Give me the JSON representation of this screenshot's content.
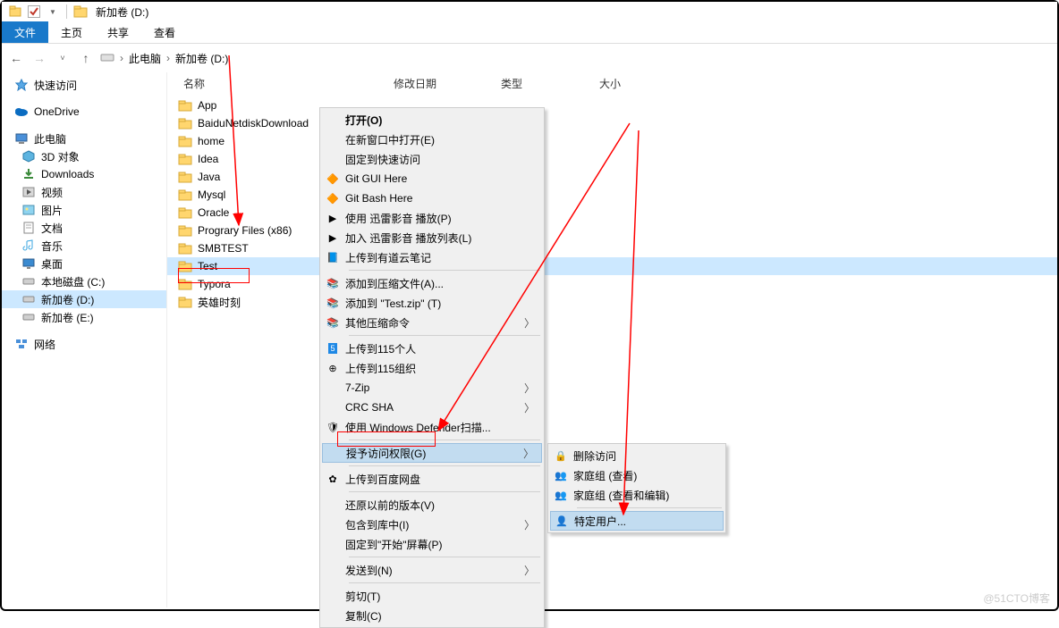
{
  "title": "新加卷 (D:)",
  "tabs": {
    "file": "文件",
    "home": "主页",
    "share": "共享",
    "view": "查看"
  },
  "breadcrumb": {
    "pc": "此电脑",
    "drive": "新加卷 (D:)"
  },
  "columns": {
    "name": "名称",
    "date": "修改日期",
    "type": "类型",
    "size": "大小"
  },
  "sidebar": {
    "quick": "快速访问",
    "onedrive": "OneDrive",
    "pc": "此电脑",
    "items": [
      {
        "label": "3D 对象"
      },
      {
        "label": "Downloads"
      },
      {
        "label": "视频"
      },
      {
        "label": "图片"
      },
      {
        "label": "文档"
      },
      {
        "label": "音乐"
      },
      {
        "label": "桌面"
      },
      {
        "label": "本地磁盘 (C:)"
      },
      {
        "label": "新加卷 (D:)"
      },
      {
        "label": "新加卷 (E:)"
      }
    ],
    "network": "网络"
  },
  "files": [
    {
      "name": "App"
    },
    {
      "name": "BaiduNetdiskDownload"
    },
    {
      "name": "home"
    },
    {
      "name": "Idea"
    },
    {
      "name": "Java"
    },
    {
      "name": "Mysql"
    },
    {
      "name": "Oracle"
    },
    {
      "name": "Prograry Files (x86)"
    },
    {
      "name": "SMBTEST"
    },
    {
      "name": "Test"
    },
    {
      "name": "Typora"
    },
    {
      "name": "英雄时刻"
    }
  ],
  "ctx": {
    "items": [
      {
        "label": "打开(O)",
        "bold": true
      },
      {
        "label": "在新窗口中打开(E)"
      },
      {
        "label": "固定到快速访问"
      },
      {
        "label": "Git GUI Here",
        "icon": "git"
      },
      {
        "label": "Git Bash Here",
        "icon": "git"
      },
      {
        "label": "使用 迅雷影音 播放(P)",
        "icon": "play"
      },
      {
        "label": "加入 迅雷影音 播放列表(L)",
        "icon": "playlist"
      },
      {
        "label": "上传到有道云笔记",
        "icon": "note"
      },
      {
        "sep": true
      },
      {
        "label": "添加到压缩文件(A)...",
        "icon": "zip"
      },
      {
        "label": "添加到 \"Test.zip\" (T)",
        "icon": "zip"
      },
      {
        "label": "其他压缩命令",
        "icon": "zip",
        "arrow": true
      },
      {
        "sep": true
      },
      {
        "label": "上传到115个人",
        "icon": "115"
      },
      {
        "label": "上传到115组织",
        "icon": "115b"
      },
      {
        "label": "7-Zip",
        "arrow": true
      },
      {
        "label": "CRC SHA",
        "arrow": true
      },
      {
        "label": "使用 Windows Defender扫描...",
        "icon": "shield"
      },
      {
        "sep": true
      },
      {
        "label": "授予访问权限(G)",
        "arrow": true,
        "selected": true
      },
      {
        "sep": true
      },
      {
        "label": "上传到百度网盘",
        "icon": "baidu"
      },
      {
        "sep": true
      },
      {
        "label": "还原以前的版本(V)"
      },
      {
        "label": "包含到库中(I)",
        "arrow": true
      },
      {
        "label": "固定到\"开始\"屏幕(P)"
      },
      {
        "sep": true
      },
      {
        "label": "发送到(N)",
        "arrow": true
      },
      {
        "sep": true
      },
      {
        "label": "剪切(T)"
      },
      {
        "label": "复制(C)"
      }
    ]
  },
  "submenu": {
    "items": [
      {
        "label": "删除访问",
        "icon": "del"
      },
      {
        "label": "家庭组 (查看)",
        "icon": "home"
      },
      {
        "label": "家庭组 (查看和编辑)",
        "icon": "home"
      },
      {
        "sep": true
      },
      {
        "label": "特定用户...",
        "icon": "user",
        "selected": true
      }
    ]
  },
  "watermark": "@51CTO博客"
}
